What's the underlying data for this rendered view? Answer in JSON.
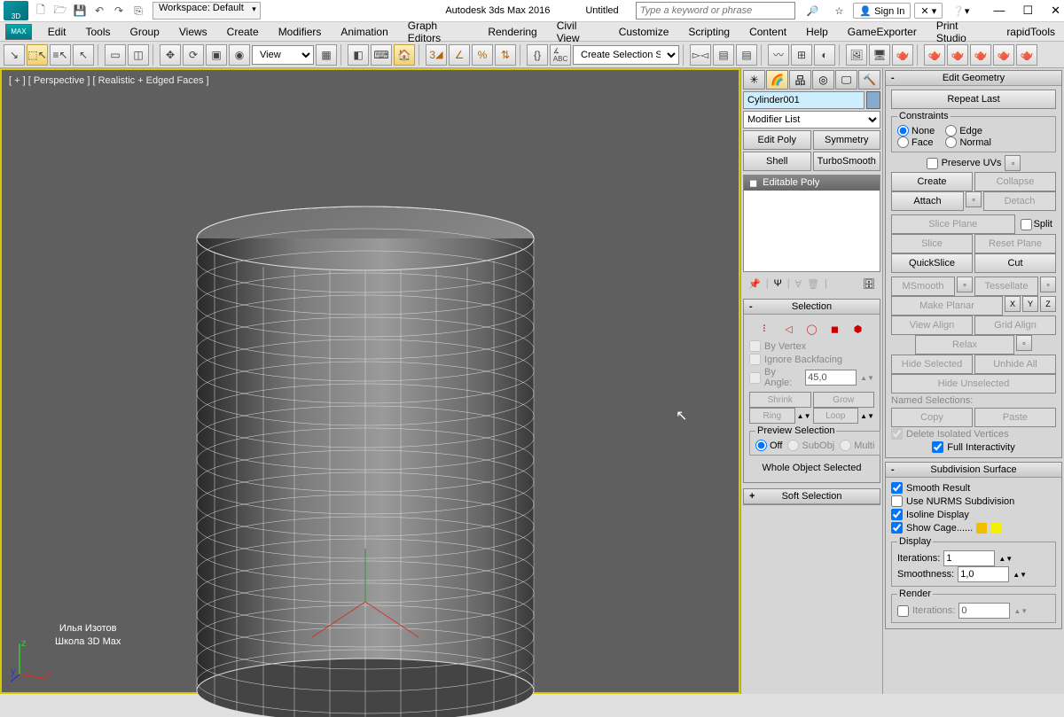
{
  "title": {
    "app": "Autodesk 3ds Max 2016",
    "doc": "Untitled"
  },
  "workspace": "Workspace: Default",
  "search_placeholder": "Type a keyword or phrase",
  "signin": "Sign In",
  "menu": [
    "Edit",
    "Tools",
    "Group",
    "Views",
    "Create",
    "Modifiers",
    "Animation",
    "Graph Editors",
    "Rendering",
    "Civil View",
    "Customize",
    "Scripting",
    "Content",
    "Help",
    "GameExporter",
    "Print Studio",
    "rapidTools"
  ],
  "toolbar": {
    "view": "View",
    "sel_filter": "Create Selection Se"
  },
  "viewport": {
    "label": "[ + ] [ Perspective ] [ Realistic + Edged Faces ]",
    "caption1": "Илья Изотов",
    "caption2": "Школа 3D Max"
  },
  "cmd": {
    "object_name": "Cylinder001",
    "modifier_list": "Modifier List",
    "quick": [
      "Edit Poly",
      "Symmetry",
      "Shell",
      "TurboSmooth"
    ],
    "stack_item": "Editable Poly",
    "selection": {
      "title": "Selection",
      "by_vertex": "By Vertex",
      "ignore_bf": "Ignore Backfacing",
      "by_angle": "By Angle:",
      "angle": "45,0",
      "shrink": "Shrink",
      "grow": "Grow",
      "ring": "Ring",
      "loop": "Loop",
      "preview_title": "Preview Selection",
      "off": "Off",
      "subobj": "SubObj",
      "multi": "Multi",
      "status": "Whole Object Selected"
    },
    "soft_sel": "Soft Selection"
  },
  "modify": {
    "edit_geom": "Edit Geometry",
    "repeat": "Repeat Last",
    "constraints": "Constraints",
    "c_none": "None",
    "c_edge": "Edge",
    "c_face": "Face",
    "c_normal": "Normal",
    "preserve_uv": "Preserve UVs",
    "create": "Create",
    "collapse": "Collapse",
    "attach": "Attach",
    "detach": "Detach",
    "slice_plane": "Slice Plane",
    "split": "Split",
    "slice": "Slice",
    "reset_plane": "Reset Plane",
    "quickslice": "QuickSlice",
    "cut": "Cut",
    "msmooth": "MSmooth",
    "tessellate": "Tessellate",
    "make_planar": "Make Planar",
    "view_align": "View Align",
    "grid_align": "Grid Align",
    "relax": "Relax",
    "hide_sel": "Hide Selected",
    "unhide_all": "Unhide All",
    "hide_unsel": "Hide Unselected",
    "named_sel": "Named Selections:",
    "copy": "Copy",
    "paste": "Paste",
    "del_iso": "Delete Isolated Vertices",
    "full_int": "Full Interactivity",
    "sub_surf": "Subdivision Surface",
    "smooth_res": "Smooth Result",
    "use_nurms": "Use NURMS Subdivision",
    "isoline": "Isoline Display",
    "show_cage": "Show Cage......",
    "display": "Display",
    "iterations": "Iterations:",
    "iter_val": "1",
    "smoothness": "Smoothness:",
    "smooth_val": "1,0",
    "render": "Render",
    "r_iterations": "Iterations:",
    "r_iter_val": "0"
  }
}
